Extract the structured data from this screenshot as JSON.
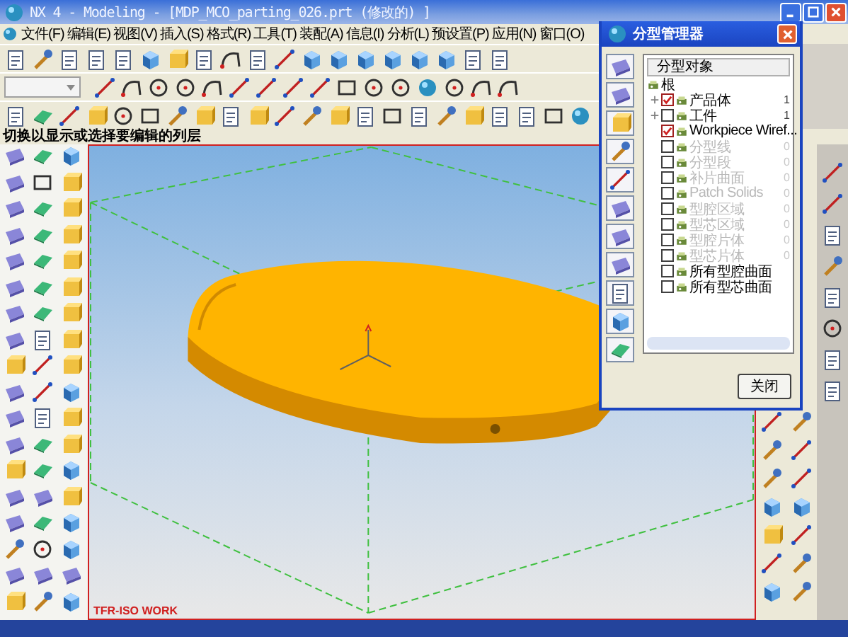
{
  "window": {
    "title": "NX 4 - Modeling - [MDP_MCO_parting_026.prt (修改的) ]"
  },
  "menu": [
    {
      "label": "文件",
      "key": "(F)"
    },
    {
      "label": "编辑",
      "key": "(E)"
    },
    {
      "label": "视图",
      "key": "(V)"
    },
    {
      "label": "插入",
      "key": "(S)"
    },
    {
      "label": "格式",
      "key": "(R)"
    },
    {
      "label": "工具",
      "key": "(T)"
    },
    {
      "label": "装配",
      "key": "(A)"
    },
    {
      "label": "信息",
      "key": "(I)"
    },
    {
      "label": "分析",
      "key": "(L)"
    },
    {
      "label": "预设置",
      "key": "(P)"
    },
    {
      "label": "应用",
      "key": "(N)"
    },
    {
      "label": "窗口",
      "key": "(O)"
    }
  ],
  "status_line": "切换以显示或选择要编辑的列层",
  "viewport": {
    "view_label": "TFR-ISO WORK"
  },
  "dialog": {
    "title": "分型管理器",
    "column": "分型对象",
    "root": {
      "label": "根",
      "children": [
        {
          "label": "产品体",
          "count": "1",
          "checked": true,
          "disabled": false,
          "expandable": true
        },
        {
          "label": "工件",
          "count": "1",
          "checked": false,
          "disabled": false,
          "expandable": true
        },
        {
          "label": "Workpiece Wiref...",
          "checked": true,
          "disabled": false,
          "expandable": false
        },
        {
          "label": "分型线",
          "count": "0",
          "checked": false,
          "disabled": true,
          "expandable": false
        },
        {
          "label": "分型段",
          "count": "0",
          "checked": false,
          "disabled": true,
          "expandable": false
        },
        {
          "label": "补片曲面",
          "count": "0",
          "checked": false,
          "disabled": true,
          "expandable": false
        },
        {
          "label": "Patch Solids",
          "count": "0",
          "checked": false,
          "disabled": true,
          "expandable": false
        },
        {
          "label": "型腔区域",
          "count": "0",
          "checked": false,
          "disabled": true,
          "expandable": false
        },
        {
          "label": "型芯区域",
          "count": "0",
          "checked": false,
          "disabled": true,
          "expandable": false
        },
        {
          "label": "型腔片体",
          "count": "0",
          "checked": false,
          "disabled": true,
          "expandable": false
        },
        {
          "label": "型芯片体",
          "count": "0",
          "checked": false,
          "disabled": true,
          "expandable": false
        },
        {
          "label": "所有型腔曲面",
          "checked": false,
          "disabled": false,
          "expandable": false
        },
        {
          "label": "所有型芯曲面",
          "checked": false,
          "disabled": false,
          "expandable": false
        }
      ]
    },
    "close_button": "关闭"
  }
}
